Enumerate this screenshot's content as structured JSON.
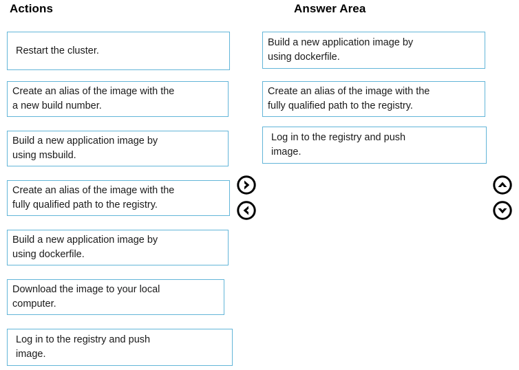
{
  "columns": {
    "actions": {
      "header": "Actions",
      "items": [
        {
          "lines": [
            "Restart the cluster."
          ],
          "indent": true
        },
        {
          "lines": [
            "Create an alias of the image with the",
            "a new build number."
          ],
          "indent": false
        },
        {
          "lines": [
            "Build a new application image by",
            "using msbuild."
          ],
          "indent": false
        },
        {
          "lines": [
            "Create an alias of the image with the",
            "fully qualified path to the registry."
          ],
          "indent": false
        },
        {
          "lines": [
            "Build a new application image by",
            "using dockerfile."
          ],
          "indent": false
        },
        {
          "lines": [
            "Download the image to your local",
            "computer."
          ],
          "indent": false
        },
        {
          "lines": [
            "Log in to the registry and push",
            "image."
          ],
          "indent": true
        }
      ]
    },
    "answer": {
      "header": "Answer Area",
      "items": [
        {
          "lines": [
            "Build a new application image by",
            "using dockerfile."
          ],
          "indent": false
        },
        {
          "lines": [
            "Create an alias of the image with the",
            "fully qualified path to the registry."
          ],
          "indent": false
        },
        {
          "lines": [
            "Log in to the registry and push",
            "image."
          ],
          "indent": true
        }
      ]
    }
  },
  "controls": {
    "move_right": {
      "label": "Move right",
      "icon": "chevron-right-circle-icon"
    },
    "move_left": {
      "label": "Move left",
      "icon": "chevron-left-circle-icon"
    },
    "move_up": {
      "label": "Move up",
      "icon": "chevron-up-circle-icon"
    },
    "move_down": {
      "label": "Move down",
      "icon": "chevron-down-circle-icon"
    }
  },
  "colors": {
    "box_border": "#62b5d8",
    "text": "#1a1a1a",
    "icon": "#000000",
    "background": "#ffffff"
  }
}
